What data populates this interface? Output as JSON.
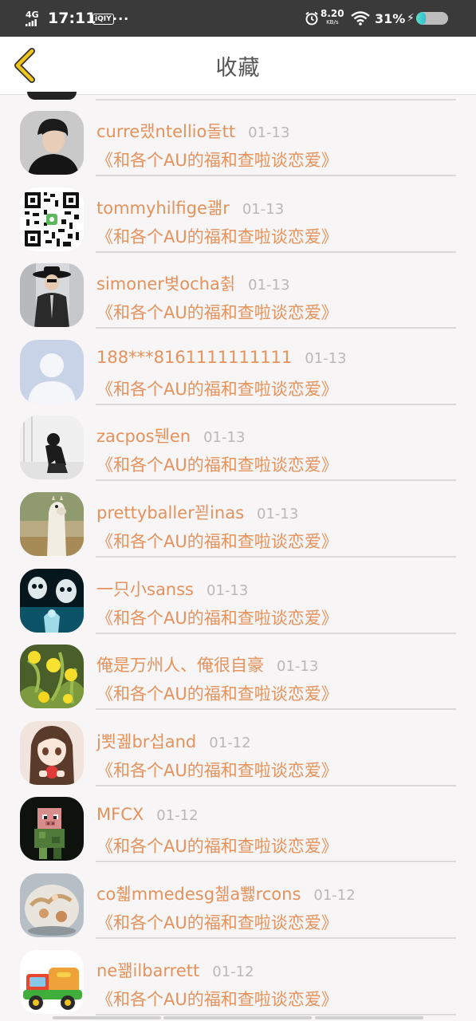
{
  "status_bar": {
    "network": "4G",
    "time": "17:11",
    "app_badge": "iQIY",
    "more": "···",
    "speed_value": "8.20",
    "speed_unit": "KB/s",
    "battery_percent": "31%",
    "battery_level": 0.31
  },
  "header": {
    "title": "收藏",
    "back_icon": "chevron-left-icon",
    "accent_color": "#f0c419"
  },
  "colors": {
    "name_text": "#e5925c",
    "date_text": "#b8b8b8",
    "title_text": "#e5925c"
  },
  "items": [
    {
      "name": "curre랬ntellio돌tt",
      "date": "01-13",
      "title": "《和各个AU的福和查啦谈恋爱》",
      "avatar": "man-portrait-avatar"
    },
    {
      "name": "tommyhilfige괢r",
      "date": "01-13",
      "title": "《和各个AU的福和查啦谈恋爱》",
      "avatar": "qr-code-avatar"
    },
    {
      "name": "simoner볒ocha췱",
      "date": "01-13",
      "title": "《和各个AU的福和查啦谈恋爱》",
      "avatar": "hat-man-avatar"
    },
    {
      "name": "188***8161111111111",
      "date": "01-13",
      "title": "《和各个AU的福和查啦谈恋爱》",
      "avatar": "default-user-avatar"
    },
    {
      "name": "zacpos뒌en",
      "date": "01-13",
      "title": "《和各个AU的福和查啦谈恋爱》",
      "avatar": "sitting-figure-avatar"
    },
    {
      "name": "prettyballer꾇inas",
      "date": "01-13",
      "title": "《和各个AU的福和查啦谈恋爱》",
      "avatar": "alpaca-avatar"
    },
    {
      "name": "一只小sanss",
      "date": "01-13",
      "title": "《和各个AU的福和查啦谈恋爱》",
      "avatar": "skeleton-art-avatar"
    },
    {
      "name": "俺是万州人、俺很自豪",
      "date": "01-13",
      "title": "《和各个AU的福和查啦谈恋爱》",
      "avatar": "dandelion-avatar"
    },
    {
      "name": "j뾧궲br섭and",
      "date": "01-12",
      "title": "《和各个AU的福和查啦谈恋爱》",
      "avatar": "anime-girl-avatar"
    },
    {
      "name": "MFCX",
      "date": "01-12",
      "title": "《和各个AU的福和查啦谈恋爱》",
      "avatar": "minecraft-pig-avatar"
    },
    {
      "name": "co췗mmedesg첾a뾇rcons",
      "date": "01-12",
      "title": "《和各个AU的福和查啦谈恋爱》",
      "avatar": "cake-avatar"
    },
    {
      "name": "ne꽮ilbarrett",
      "date": "01-12",
      "title": "《和各个AU的福和查啦谈恋爱》",
      "avatar": "toy-truck-avatar"
    }
  ]
}
